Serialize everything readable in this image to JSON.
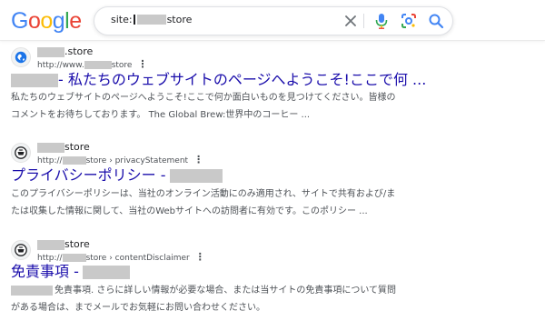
{
  "logo": {
    "text": "Google"
  },
  "search": {
    "prefix": "site:",
    "suffix": "store"
  },
  "results": [
    {
      "site_name_suffix": ".store",
      "url_prefix": "http://www.",
      "url_suffix": "store",
      "title": "- 私たちのウェブサイトのページへようこそ!ここで何 ...",
      "snippet_lines": [
        "私たちのウェブサイトのページへようこそ!ここで何か面白いものを見つけてください。皆様の",
        "コメントをお待ちしております。 The Global Brew:世界中のコーヒー ..."
      ]
    },
    {
      "site_name_suffix": "store",
      "url_prefix": "http://",
      "url_suffix": "store › privacyStatement",
      "title": "プライバシーポリシー -",
      "snippet_lines": [
        "このプライバシーポリシーは、当社のオンライン活動にのみ適用され、サイトで共有および/ま",
        "たは収集した情報に関して、当社のWebサイトへの訪問者に有効です。このポリシー ..."
      ]
    },
    {
      "site_name_suffix": "store",
      "url_prefix": "http://",
      "url_suffix": "store › contentDisclaimer",
      "title": "免責事項 -",
      "snippet_lines": [
        "免責事項. さらに詳しい情報が必要な場合、または当サイトの免責事項について質問",
        "がある場合は、までメールでお気軽にお問い合わせください。"
      ]
    }
  ]
}
